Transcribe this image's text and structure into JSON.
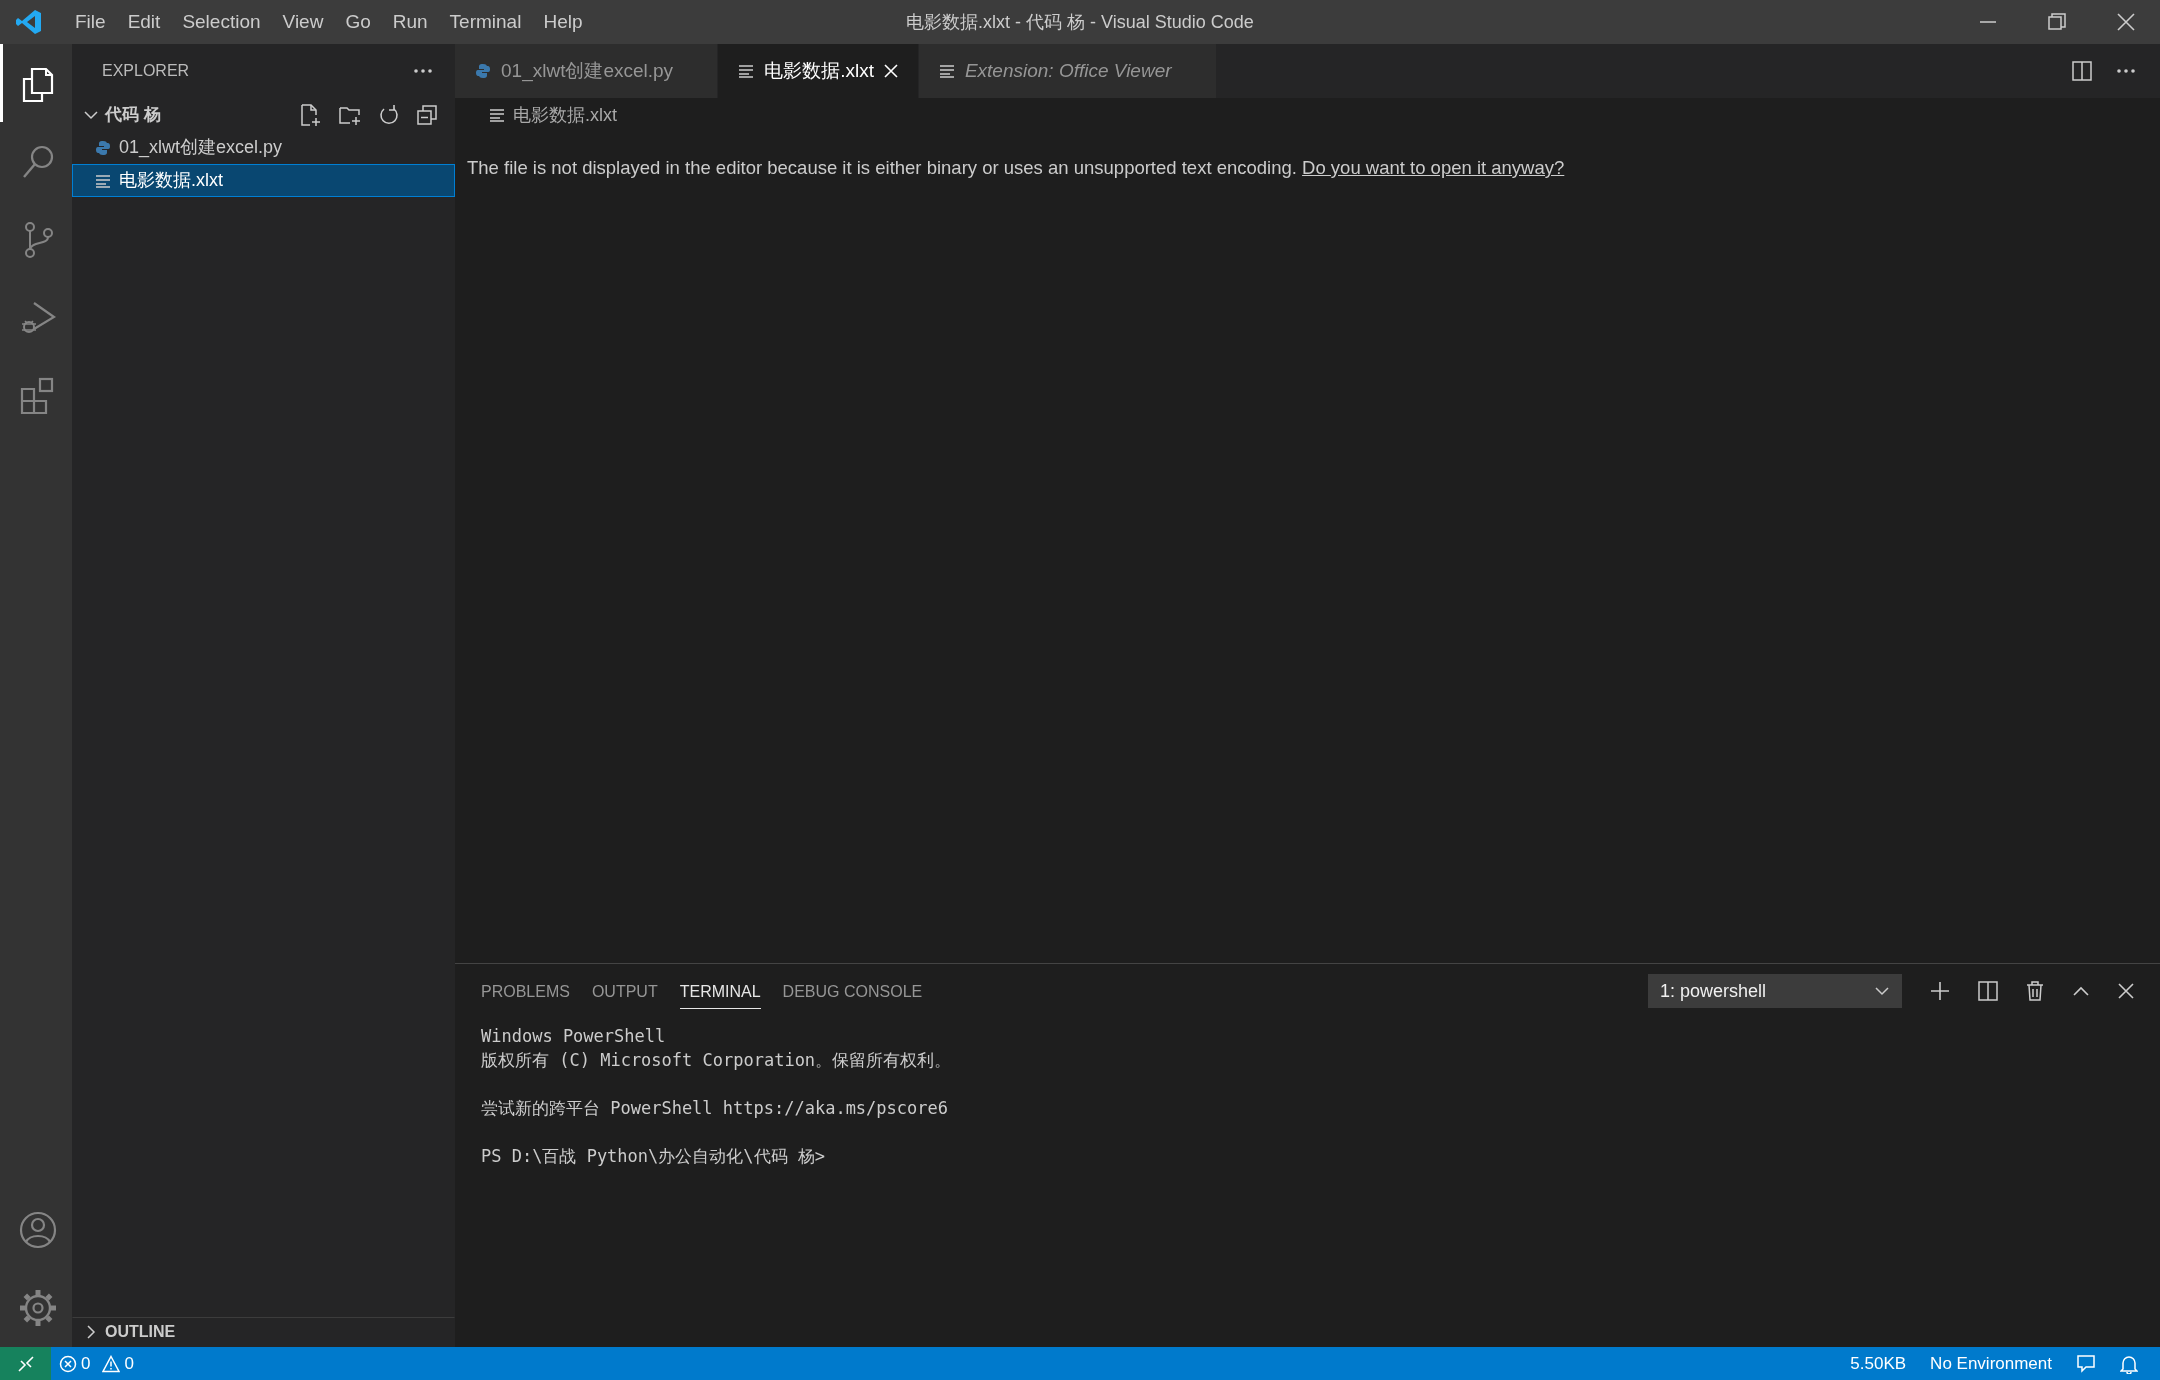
{
  "title_bar": {
    "menu": [
      "File",
      "Edit",
      "Selection",
      "View",
      "Go",
      "Run",
      "Terminal",
      "Help"
    ],
    "title": "电影数据.xlxt - 代码 杨 - Visual Studio Code"
  },
  "activity_bar": {
    "items": [
      {
        "kind": "files",
        "selected": true
      },
      {
        "kind": "search",
        "selected": false
      },
      {
        "kind": "source-control",
        "selected": false
      },
      {
        "kind": "run",
        "selected": false
      },
      {
        "kind": "extensions",
        "selected": false
      }
    ],
    "bottom_items": [
      {
        "kind": "account",
        "selected": false
      },
      {
        "kind": "settings",
        "selected": false
      }
    ]
  },
  "sidebar": {
    "title": "EXPLORER",
    "folder": {
      "label": "代码 杨",
      "expanded": true,
      "files": [
        {
          "name": "01_xlwt创建excel.py",
          "kind": "python",
          "selected": false
        },
        {
          "name": "电影数据.xlxt",
          "kind": "text",
          "selected": true
        }
      ]
    },
    "outline": {
      "label": "OUTLINE",
      "expanded": false
    }
  },
  "editor": {
    "tabs": [
      {
        "label": "01_xlwt创建excel.py",
        "kind": "python",
        "selected": false,
        "preview": false
      },
      {
        "label": "电影数据.xlxt",
        "kind": "text",
        "selected": true,
        "preview": false
      },
      {
        "label": "Extension: Office Viewer",
        "kind": "text",
        "selected": false,
        "preview": true
      }
    ],
    "breadcrumb": "电影数据.xlxt",
    "message": "The file is not displayed in the editor because it is either binary or uses an unsupported text encoding.",
    "link": "Do you want to open it anyway?"
  },
  "panel": {
    "tabs": [
      {
        "label": "PROBLEMS",
        "selected": false
      },
      {
        "label": "OUTPUT",
        "selected": false
      },
      {
        "label": "TERMINAL",
        "selected": true
      },
      {
        "label": "DEBUG CONSOLE",
        "selected": false
      }
    ],
    "terminal_select": "1: powershell",
    "terminal_blocks": [
      [
        "Windows PowerShell",
        "版权所有 (C) Microsoft Corporation。保留所有权利。"
      ],
      [
        "尝试新的跨平台 PowerShell https://aka.ms/pscore6"
      ],
      [
        "PS D:\\百战 Python\\办公自动化\\代码 杨>"
      ]
    ]
  },
  "status_bar": {
    "errors": "0",
    "warnings": "0",
    "size": "5.50KB",
    "environment": "No Environment"
  }
}
